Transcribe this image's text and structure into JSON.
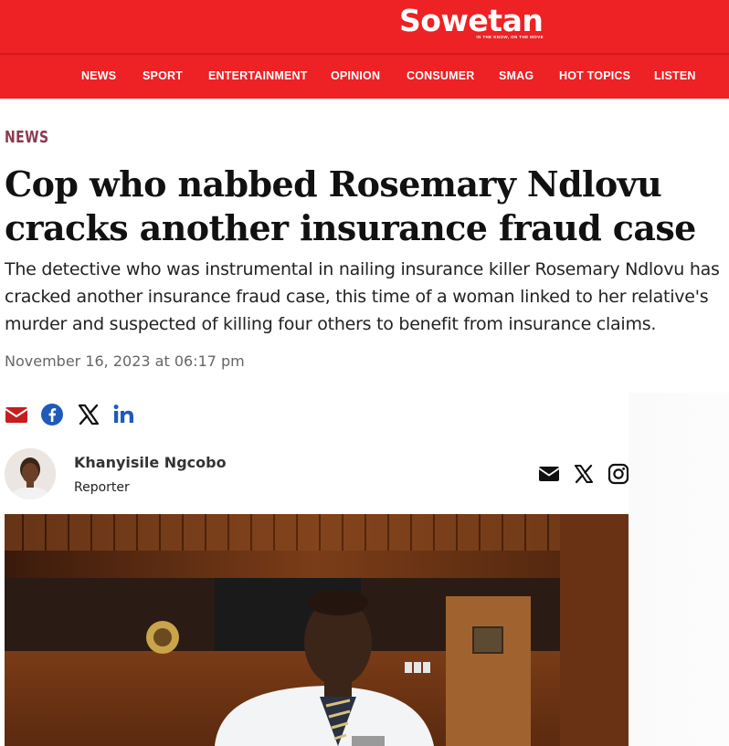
{
  "brand": {
    "name": "Sowetan",
    "tagline": "IN THE KNOW, ON THE MOVE",
    "primary_color": "#ee2124"
  },
  "nav": {
    "items": [
      "NEWS",
      "SPORT",
      "ENTERTAINMENT",
      "OPINION",
      "CONSUMER",
      "SMAG",
      "HOT TOPICS",
      "LISTEN"
    ]
  },
  "article": {
    "section": "NEWS",
    "headline": "Cop who nabbed Rosemary Ndlovu cracks another insurance fraud case",
    "standfirst": "The detective who was instrumental in nailing insurance killer Rosemary Ndlovu has cracked another insurance fraud case, this time of a woman linked to her relative's murder and suspected of killing four others to benefit from insurance claims.",
    "date": "November 16, 2023 at 06:17 pm"
  },
  "share_icons": [
    "envelope-icon",
    "facebook-icon",
    "x-icon",
    "linkedin-icon"
  ],
  "author": {
    "name": "Khanyisile Ngcobo",
    "role": "Reporter",
    "icons": [
      "envelope-icon",
      "x-icon",
      "instagram-icon"
    ]
  },
  "colors": {
    "section_label": "#8a3a4f",
    "email_share": "#c41e1e",
    "facebook": "#1f5bb8",
    "linkedin": "#1f5bb8",
    "date": "#666666"
  }
}
